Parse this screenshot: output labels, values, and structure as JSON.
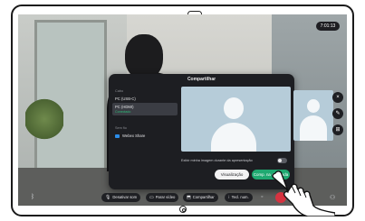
{
  "status": {
    "call_timer": "7:01:13"
  },
  "dialog": {
    "title": "Compartilhar",
    "cable_section": "Cabo",
    "sources": [
      {
        "label": "PC (USB-C)",
        "status": ""
      },
      {
        "label": "PC (HDMI)",
        "status": "Conectado"
      }
    ],
    "wireless_section": "Sem fio",
    "webex_share": "Webex Share",
    "toggle_label": "Exibir minha imagem durante da apresentação",
    "preview_button": "Visualização",
    "share_in_call_button": "Comp. na chamada"
  },
  "bottom_bar": {
    "mute": "Desativar som",
    "stop_video": "Parar vídeo",
    "share": "Compartilhar",
    "touch_tones": "Tecl. num."
  },
  "colors": {
    "accent_green": "#1fa971",
    "end_call_red": "#d63340",
    "status_green": "#2dbd78"
  },
  "icons": [
    "camera-icon",
    "home-button-icon",
    "microphone-icon",
    "video-icon",
    "share-icon",
    "keypad-icon",
    "end-call-icon",
    "bluetooth-icon",
    "people-icon",
    "layout-icon",
    "edit-icon",
    "close-icon"
  ]
}
